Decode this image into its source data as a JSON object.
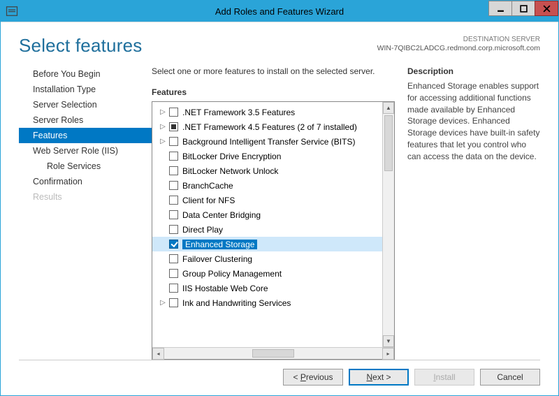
{
  "window": {
    "title": "Add Roles and Features Wizard"
  },
  "header": {
    "page_title": "Select features",
    "dest_label": "DESTINATION SERVER",
    "dest_value": "WIN-7QIBC2LADCG.redmond.corp.microsoft.com"
  },
  "sidebar": {
    "items": [
      {
        "label": "Before You Begin",
        "active": false
      },
      {
        "label": "Installation Type",
        "active": false
      },
      {
        "label": "Server Selection",
        "active": false
      },
      {
        "label": "Server Roles",
        "active": false
      },
      {
        "label": "Features",
        "active": true
      },
      {
        "label": "Web Server Role (IIS)",
        "active": false
      },
      {
        "label": "Role Services",
        "active": false,
        "sub": true
      },
      {
        "label": "Confirmation",
        "active": false
      },
      {
        "label": "Results",
        "active": false,
        "disabled": true
      }
    ]
  },
  "content": {
    "instruction": "Select one or more features to install on the selected server.",
    "features_label": "Features",
    "description_label": "Description",
    "description_text": "Enhanced Storage enables support for accessing additional functions made available by Enhanced Storage devices. Enhanced Storage devices have built-in safety features that let you control who can access the data on the device.",
    "features": [
      {
        "label": ".NET Framework 3.5 Features",
        "state": "unchecked",
        "expandable": true
      },
      {
        "label": ".NET Framework 4.5 Features (2 of 7 installed)",
        "state": "indet",
        "expandable": true
      },
      {
        "label": "Background Intelligent Transfer Service (BITS)",
        "state": "unchecked",
        "expandable": true
      },
      {
        "label": "BitLocker Drive Encryption",
        "state": "unchecked"
      },
      {
        "label": "BitLocker Network Unlock",
        "state": "unchecked"
      },
      {
        "label": "BranchCache",
        "state": "unchecked"
      },
      {
        "label": "Client for NFS",
        "state": "unchecked"
      },
      {
        "label": "Data Center Bridging",
        "state": "unchecked"
      },
      {
        "label": "Direct Play",
        "state": "unchecked"
      },
      {
        "label": "Enhanced Storage",
        "state": "checked",
        "selected": true
      },
      {
        "label": "Failover Clustering",
        "state": "unchecked"
      },
      {
        "label": "Group Policy Management",
        "state": "unchecked"
      },
      {
        "label": "IIS Hostable Web Core",
        "state": "unchecked"
      },
      {
        "label": "Ink and Handwriting Services",
        "state": "unchecked",
        "expandable": true
      }
    ]
  },
  "footer": {
    "previous": "Previous",
    "next": "Next",
    "install": "Install",
    "cancel": "Cancel"
  }
}
